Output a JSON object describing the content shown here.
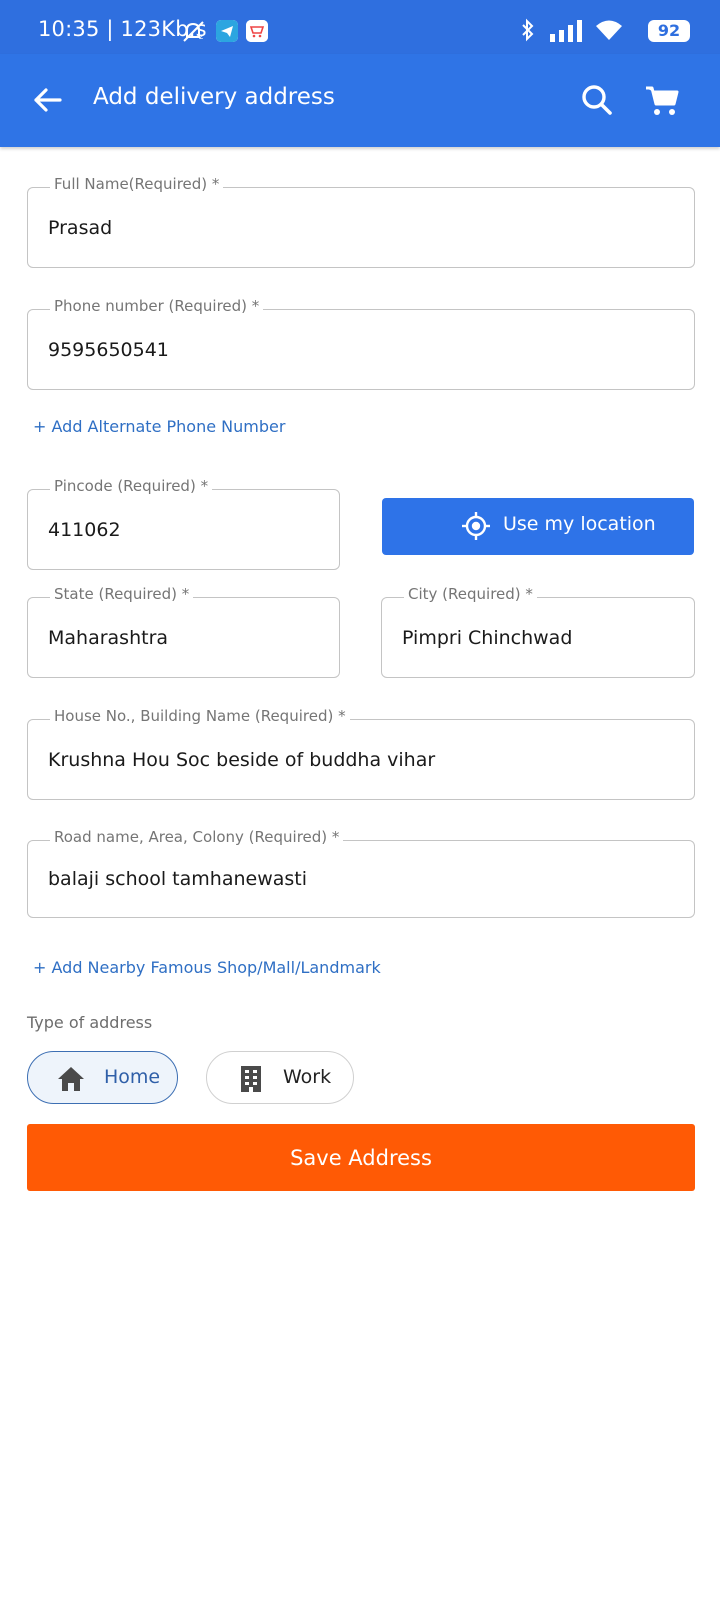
{
  "status_bar": {
    "time": "10:35 | 123Kb.s",
    "battery": "92"
  },
  "header": {
    "title": "Add delivery address"
  },
  "form": {
    "full_name": {
      "label": "Full Name(Required) *",
      "value": "Prasad"
    },
    "phone": {
      "label": "Phone number (Required) *",
      "value": "9595650541"
    },
    "add_alternate_phone": "+ Add Alternate Phone Number",
    "pincode": {
      "label": "Pincode (Required) *",
      "value": "411062"
    },
    "use_location": "Use my location",
    "state": {
      "label": "State (Required) *",
      "value": "Maharashtra"
    },
    "city": {
      "label": "City (Required) *",
      "value": "Pimpri Chinchwad"
    },
    "house": {
      "label": "House No., Building Name (Required) *",
      "value": "Krushna Hou Soc beside of buddha vihar"
    },
    "road": {
      "label": "Road name, Area, Colony (Required) *",
      "value": "balaji school tamhanewasti"
    },
    "add_landmark": "+ Add Nearby Famous Shop/Mall/Landmark",
    "address_type_label": "Type of address",
    "address_types": [
      {
        "label": "Home",
        "icon": "home-icon",
        "selected": true
      },
      {
        "label": "Work",
        "icon": "building-icon",
        "selected": false
      }
    ],
    "save_label": "Save Address"
  },
  "colors": {
    "app_bar": "#2f74e6",
    "primary_button": "#2e73e8",
    "save_button": "#ff5a05",
    "link": "#2f6fc4"
  }
}
